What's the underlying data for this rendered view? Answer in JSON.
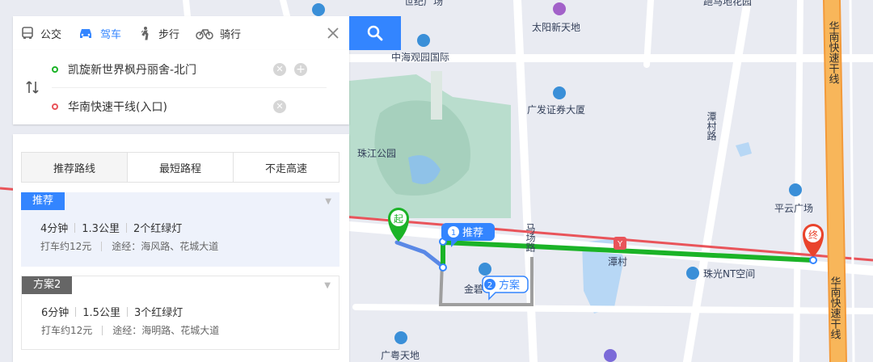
{
  "modes": [
    {
      "id": "bus",
      "label": "公交",
      "icon": "bus-icon"
    },
    {
      "id": "drive",
      "label": "驾车",
      "icon": "car-icon"
    },
    {
      "id": "walk",
      "label": "步行",
      "icon": "walk-icon"
    },
    {
      "id": "bike",
      "label": "骑行",
      "icon": "bike-icon"
    }
  ],
  "active_mode": "drive",
  "start": "凯旋新世界枫丹丽舍-北门",
  "end": "华南快速干线(入口)",
  "tabs": [
    "推荐路线",
    "最短路程",
    "不走高速"
  ],
  "plans": [
    {
      "badge": "推荐",
      "time": "4分钟",
      "distance": "1.3公里",
      "lights": "2个红绿灯",
      "taxi": "打车约12元",
      "via": "途经：海风路、花城大道"
    },
    {
      "badge": "方案2",
      "time": "6分钟",
      "distance": "1.5公里",
      "lights": "3个红绿灯",
      "taxi": "打车约12元",
      "via": "途经：海明路、花城大道"
    }
  ],
  "map": {
    "labels": {
      "zhujiang_park": "珠江公园",
      "zhonghai": "中海观园国际",
      "taiyang": "太阳新天地",
      "guangfa": "广发证券大厦",
      "pingyun": "平云广场",
      "zhuguang": "珠光NT空间",
      "tancun_metro": "潭村",
      "jinju": "金碧",
      "guangyue": "广粤天地",
      "top_partial_1": "世纪广场",
      "top_partial_2": "跑马地花园",
      "tancun_road": "潭村路",
      "mashang_road": "马场路",
      "expressway": "华南快速干线",
      "start_marker": "起",
      "end_marker": "终",
      "route1_tag_num": "1",
      "route1_tag": "推荐",
      "route2_tag_num": "2",
      "route2_tag": "方案"
    },
    "colors": {
      "route_main": "#1bb327",
      "route_start": "#5a88e6",
      "route_alt": "#9e9e9e",
      "metro": "#e9545a",
      "expressway": "#f39a3a",
      "accent": "#3385ff"
    }
  }
}
